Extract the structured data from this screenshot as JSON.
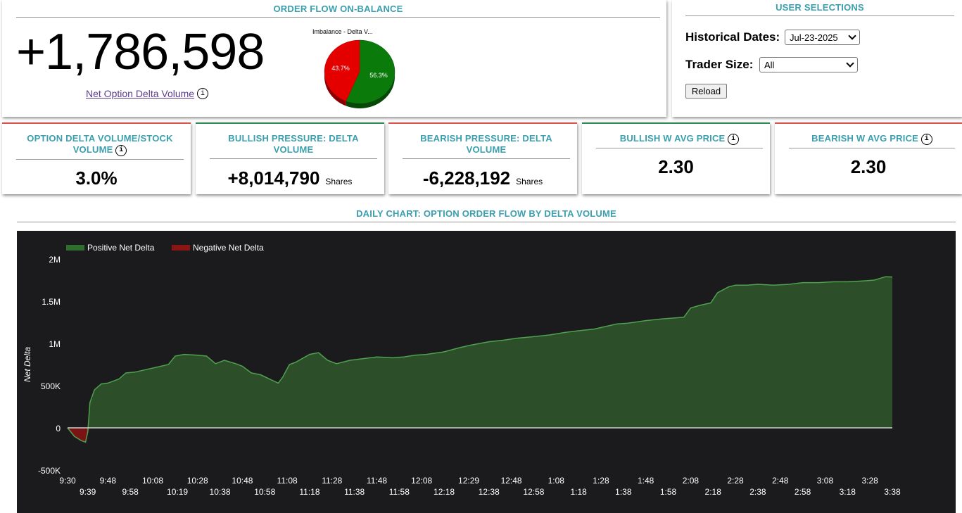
{
  "onbalance": {
    "title": "ORDER FLOW ON-BALANCE",
    "big_number": "+1,786,598",
    "net_link": "Net Option Delta Volume",
    "info_glyph": "i",
    "pie": {
      "title": "Imbalance - Delta V...",
      "slices": [
        {
          "label": "56.3%",
          "value": 56.3,
          "color": "#0a7a0a"
        },
        {
          "label": "43.7%",
          "value": 43.7,
          "color": "#e50000"
        }
      ]
    }
  },
  "user": {
    "title": "USER SELECTIONS",
    "historical_label": "Historical Dates:",
    "historical_value": "Jul-23-2025",
    "trader_label": "Trader Size:",
    "trader_value": "All",
    "reload_label": "Reload"
  },
  "cards": {
    "c1": {
      "title": "OPTION DELTA VOLUME/STOCK VOLUME",
      "value": "3.0%"
    },
    "c2": {
      "title": "BULLISH PRESSURE: DELTA VOLUME",
      "value": "+8,014,790",
      "unit": "Shares"
    },
    "c3": {
      "title": "BEARISH PRESSURE: DELTA VOLUME",
      "value": "-6,228,192",
      "unit": "Shares"
    },
    "c4": {
      "title": "BULLISH W AVG PRICE",
      "value": "2.30"
    },
    "c5": {
      "title": "BEARISH W AVG PRICE",
      "value": "2.30"
    }
  },
  "chart_data": {
    "type": "area",
    "title": "DAILY CHART: OPTION ORDER FLOW BY DELTA VOLUME",
    "ylabel": "Net Delta",
    "ylim": [
      -500000,
      2000000
    ],
    "yticks": [
      {
        "value": 2000000,
        "label": "2M"
      },
      {
        "value": 1500000,
        "label": "1.5M"
      },
      {
        "value": 1000000,
        "label": "1M"
      },
      {
        "value": 500000,
        "label": "500K"
      },
      {
        "value": 0,
        "label": "0"
      },
      {
        "value": -500000,
        "label": "-500K"
      }
    ],
    "xticks_top": [
      "9:30",
      "9:48",
      "10:08",
      "10:28",
      "10:48",
      "11:08",
      "11:28",
      "11:48",
      "12:08",
      "12:29",
      "12:48",
      "1:08",
      "1:28",
      "1:48",
      "2:08",
      "2:28",
      "2:48",
      "3:08",
      "3:28"
    ],
    "xticks_bottom": [
      "9:39",
      "9:58",
      "10:19",
      "10:38",
      "10:58",
      "11:18",
      "11:38",
      "11:58",
      "12:18",
      "12:38",
      "12:58",
      "1:18",
      "1:38",
      "1:58",
      "2:18",
      "2:38",
      "2:58",
      "3:18",
      "3:38"
    ],
    "legend": [
      {
        "name": "Positive Net Delta",
        "color": "#2f6e2f"
      },
      {
        "name": "Negative Net Delta",
        "color": "#8b1414"
      }
    ],
    "legend_position": "top-left",
    "x_start": "9:30",
    "x_end": "3:38",
    "series": [
      {
        "name": "Net Delta",
        "points": [
          [
            "9:30",
            0
          ],
          [
            "9:33",
            -100000
          ],
          [
            "9:36",
            -150000
          ],
          [
            "9:38",
            -170000
          ],
          [
            "9:39",
            -50000
          ],
          [
            "9:40",
            300000
          ],
          [
            "9:42",
            450000
          ],
          [
            "9:45",
            520000
          ],
          [
            "9:48",
            530000
          ],
          [
            "9:53",
            580000
          ],
          [
            "9:56",
            650000
          ],
          [
            "10:00",
            660000
          ],
          [
            "10:05",
            690000
          ],
          [
            "10:10",
            720000
          ],
          [
            "10:15",
            750000
          ],
          [
            "10:18",
            850000
          ],
          [
            "10:22",
            870000
          ],
          [
            "10:28",
            860000
          ],
          [
            "10:32",
            850000
          ],
          [
            "10:36",
            760000
          ],
          [
            "10:40",
            800000
          ],
          [
            "10:45",
            760000
          ],
          [
            "10:48",
            730000
          ],
          [
            "10:52",
            650000
          ],
          [
            "10:56",
            630000
          ],
          [
            "11:00",
            580000
          ],
          [
            "11:04",
            530000
          ],
          [
            "11:06",
            600000
          ],
          [
            "11:09",
            750000
          ],
          [
            "11:12",
            780000
          ],
          [
            "11:18",
            870000
          ],
          [
            "11:22",
            890000
          ],
          [
            "11:26",
            800000
          ],
          [
            "11:30",
            760000
          ],
          [
            "11:36",
            800000
          ],
          [
            "11:42",
            820000
          ],
          [
            "11:48",
            840000
          ],
          [
            "11:55",
            830000
          ],
          [
            "12:00",
            840000
          ],
          [
            "12:05",
            860000
          ],
          [
            "12:10",
            870000
          ],
          [
            "12:18",
            900000
          ],
          [
            "12:25",
            950000
          ],
          [
            "12:30",
            980000
          ],
          [
            "12:38",
            1020000
          ],
          [
            "12:45",
            1040000
          ],
          [
            "12:50",
            1060000
          ],
          [
            "12:58",
            1080000
          ],
          [
            "1:05",
            1100000
          ],
          [
            "1:12",
            1130000
          ],
          [
            "1:18",
            1150000
          ],
          [
            "1:25",
            1170000
          ],
          [
            "1:30",
            1200000
          ],
          [
            "1:35",
            1230000
          ],
          [
            "1:40",
            1240000
          ],
          [
            "1:48",
            1270000
          ],
          [
            "1:55",
            1290000
          ],
          [
            "2:00",
            1300000
          ],
          [
            "2:05",
            1310000
          ],
          [
            "2:08",
            1420000
          ],
          [
            "2:12",
            1450000
          ],
          [
            "2:17",
            1480000
          ],
          [
            "2:20",
            1600000
          ],
          [
            "2:25",
            1670000
          ],
          [
            "2:28",
            1690000
          ],
          [
            "2:33",
            1690000
          ],
          [
            "2:38",
            1700000
          ],
          [
            "2:45",
            1690000
          ],
          [
            "2:52",
            1700000
          ],
          [
            "2:58",
            1720000
          ],
          [
            "3:05",
            1720000
          ],
          [
            "3:12",
            1730000
          ],
          [
            "3:18",
            1730000
          ],
          [
            "3:25",
            1740000
          ],
          [
            "3:30",
            1750000
          ],
          [
            "3:35",
            1790000
          ],
          [
            "3:38",
            1786598
          ]
        ]
      }
    ]
  }
}
